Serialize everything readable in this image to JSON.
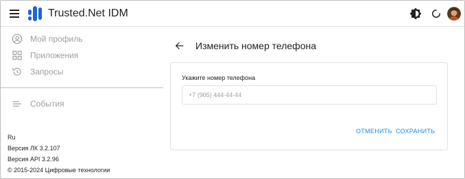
{
  "header": {
    "app_title": "Trusted.Net IDM",
    "menu_icon": "menu-icon",
    "logo_icon": "logo-icon",
    "theme_icon": "theme-toggle-icon",
    "refresh_icon": "refresh-icon",
    "avatar": "user-avatar"
  },
  "sidebar": {
    "items": [
      {
        "label": "Мой профиль",
        "icon": "account-circle-icon"
      },
      {
        "label": "Приложения",
        "icon": "apps-grid-icon"
      },
      {
        "label": "Запросы",
        "icon": "history-icon"
      },
      {
        "label": "События",
        "icon": "list-icon"
      }
    ],
    "footer": {
      "language": "Ru",
      "lk_version": "Версия ЛК 3.2.107",
      "api_version": "Версия API 3.2.96",
      "copyright": "© 2015-2024 Цифровые технологии"
    }
  },
  "main": {
    "back_icon": "arrow-back-icon",
    "title": "Изменить номер телефона",
    "form": {
      "label": "Укажите номер телефона",
      "phone_value": "",
      "phone_placeholder": "+7 (905) 444-44-44",
      "cancel_label": "ОТМЕНИТЬ",
      "save_label": "СОХРАНИТЬ"
    }
  },
  "colors": {
    "accent": "#1e88e5",
    "logo": "#1e63d8",
    "muted_text": "#9e9e9e",
    "border": "#e0e0e0"
  }
}
